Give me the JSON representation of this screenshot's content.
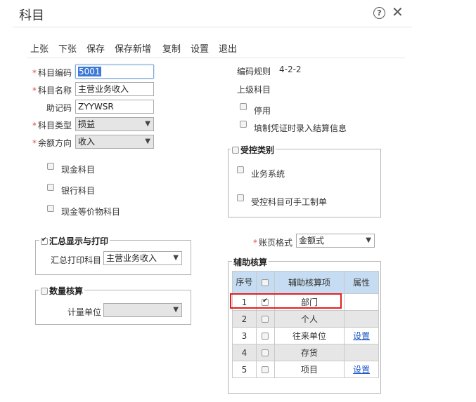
{
  "window": {
    "title": "科目"
  },
  "toolbar": {
    "prev": "上张",
    "next": "下张",
    "save": "保存",
    "save_new": "保存新增",
    "copy": "复制",
    "settings": "设置",
    "exit": "退出"
  },
  "form": {
    "code_label": "科目编码",
    "code_value": "5001",
    "name_label": "科目名称",
    "name_value": "主营业务收入",
    "mnemonic_label": "助记码",
    "mnemonic_value": "ZYYWSR",
    "type_label": "科目类型",
    "type_value": "损益",
    "balance_label": "余额方向",
    "balance_value": "收入",
    "cash_label": "现金科目",
    "bank_label": "银行科目",
    "cash_equiv_label": "现金等价物科目"
  },
  "summary": {
    "legend": "汇总显示与打印",
    "print_label": "汇总打印科目",
    "print_value": "主营业务收入"
  },
  "quantity": {
    "legend": "数量核算",
    "unit_label": "计量单位",
    "unit_value": ""
  },
  "right": {
    "rule_label": "编码规则",
    "rule_value": "4-2-2",
    "parent_label": "上级科目",
    "disable_label": "停用",
    "settle_label": "填制凭证时录入结算信息",
    "controlled_legend": "受控类别",
    "business_label": "业务系统",
    "manual_label": "受控科目可手工制单",
    "ledger_label": "账页格式",
    "ledger_value": "金额式"
  },
  "aux": {
    "legend": "辅助核算",
    "columns": [
      "序号",
      "辅助核算项",
      "属性"
    ],
    "rows": [
      {
        "no": "1",
        "item": "部门",
        "attr": ""
      },
      {
        "no": "2",
        "item": "个人",
        "attr": ""
      },
      {
        "no": "3",
        "item": "往来单位",
        "attr": "设置"
      },
      {
        "no": "4",
        "item": "存货",
        "attr": ""
      },
      {
        "no": "5",
        "item": "项目",
        "attr": "设置"
      }
    ]
  },
  "colors": {
    "header_blue": "#c6dcf2",
    "highlight_red": "#e02020",
    "link_blue": "#1a56c8",
    "required_red": "#d9534f"
  }
}
